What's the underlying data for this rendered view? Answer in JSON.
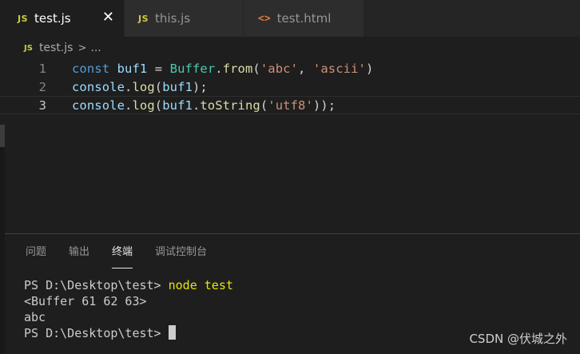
{
  "tabs": [
    {
      "label": "test.js",
      "badge": "JS",
      "active": true,
      "close": "✕"
    },
    {
      "label": "this.js",
      "badge": "JS",
      "active": false
    },
    {
      "label": "test.html",
      "badge": "<>",
      "active": false
    }
  ],
  "breadcrumb": {
    "badge": "JS",
    "file": "test.js",
    "separator": ">",
    "more": "..."
  },
  "editor": {
    "lines": [
      {
        "number": "1",
        "text": "const buf1 = Buffer.from('abc', 'ascii')"
      },
      {
        "number": "2",
        "text": "console.log(buf1);"
      },
      {
        "number": "3",
        "text": "console.log(buf1.toString('utf8'));"
      }
    ],
    "current_line": 3
  },
  "panel": {
    "tabs": [
      "问题",
      "输出",
      "终端",
      "调试控制台"
    ],
    "active_tab": "终端"
  },
  "terminal": {
    "lines": [
      {
        "prompt": "PS D:\\Desktop\\test> ",
        "command": "node test"
      },
      {
        "output": "<Buffer 61 62 63>"
      },
      {
        "output": "abc"
      },
      {
        "prompt": "PS D:\\Desktop\\test> ",
        "command": ""
      }
    ]
  },
  "watermark": "CSDN @伏城之外",
  "colors": {
    "background": "#1e1e1e",
    "js_badge": "#cbcb41",
    "html_badge": "#e37933",
    "keyword": "#569cd6",
    "variable": "#9cdcfe",
    "class": "#4ec9b0",
    "function": "#dcdcaa",
    "string": "#ce9178",
    "terminal_command": "#e5e510"
  },
  "icons": {
    "js_file": "js-file-icon",
    "html_file": "html-file-icon",
    "close": "close-icon"
  }
}
